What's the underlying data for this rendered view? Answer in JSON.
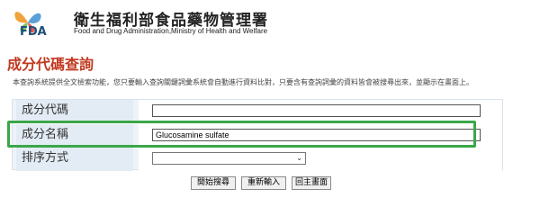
{
  "header": {
    "logo_text": "FDA",
    "org_name_zh": "衛生福利部食品藥物管理署",
    "org_name_en": "Food and Drug Administration,Ministry of Health and Welfare"
  },
  "page": {
    "title": "成分代碼查詢",
    "description": "本查詢系統提供全文檢索功能，您只要輸入查詢關鍵詞彙系統會自動進行資料比對，只要含有查詢詞彙的資料皆會被搜尋出來，並顯示在畫面上。"
  },
  "form": {
    "rows": [
      {
        "label": "成分代碼",
        "value": ""
      },
      {
        "label": "成分名稱",
        "value": "Glucosamine sulfate"
      },
      {
        "label": "排序方式",
        "value": ""
      }
    ]
  },
  "buttons": {
    "search": "開始搜尋",
    "reset": "重新輸入",
    "home": "回主畫面"
  },
  "colors": {
    "title": "#c0391f",
    "highlight": "#3aa648",
    "table_bg": "#eef3f9"
  }
}
